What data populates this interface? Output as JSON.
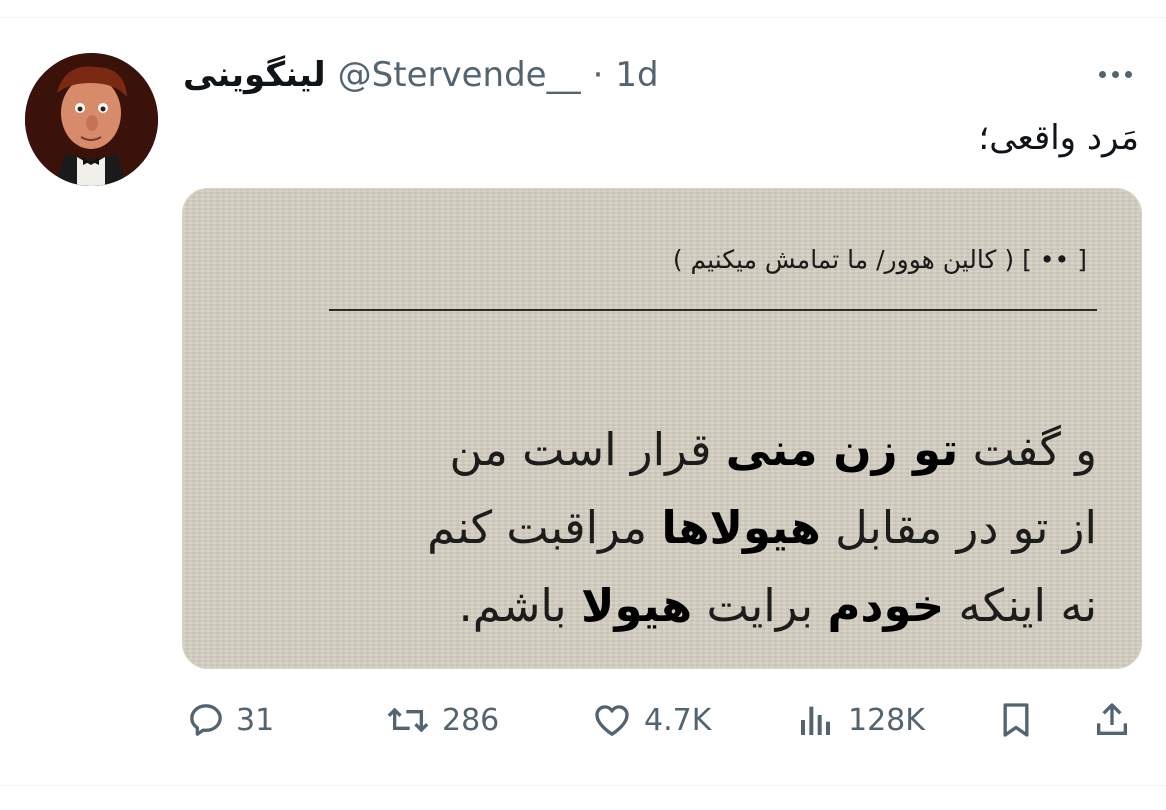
{
  "tweet": {
    "display_name": "لینگوینی",
    "handle": "@Stervende__",
    "separator": "·",
    "time": "1d",
    "text": "مَرد واقعی؛",
    "media": {
      "header": "[ •• ] ( کالین هوور/ ما تمامش میکنیم )",
      "lines": [
        [
          "و گفت ",
          "تو زن منی",
          " قرار است من"
        ],
        [
          "از تو در مقابل ",
          "هیولاها",
          " مراقبت کنم"
        ],
        [
          "نه اینکه ",
          "خودم",
          " برایت ",
          "هیولا",
          " باشم."
        ]
      ]
    },
    "actions": {
      "replies": "31",
      "reposts": "286",
      "likes": "4.7K",
      "views": "128K"
    },
    "icons": [
      "more-icon",
      "reply-icon",
      "repost-icon",
      "like-icon",
      "views-icon",
      "bookmark-icon",
      "share-icon"
    ]
  }
}
